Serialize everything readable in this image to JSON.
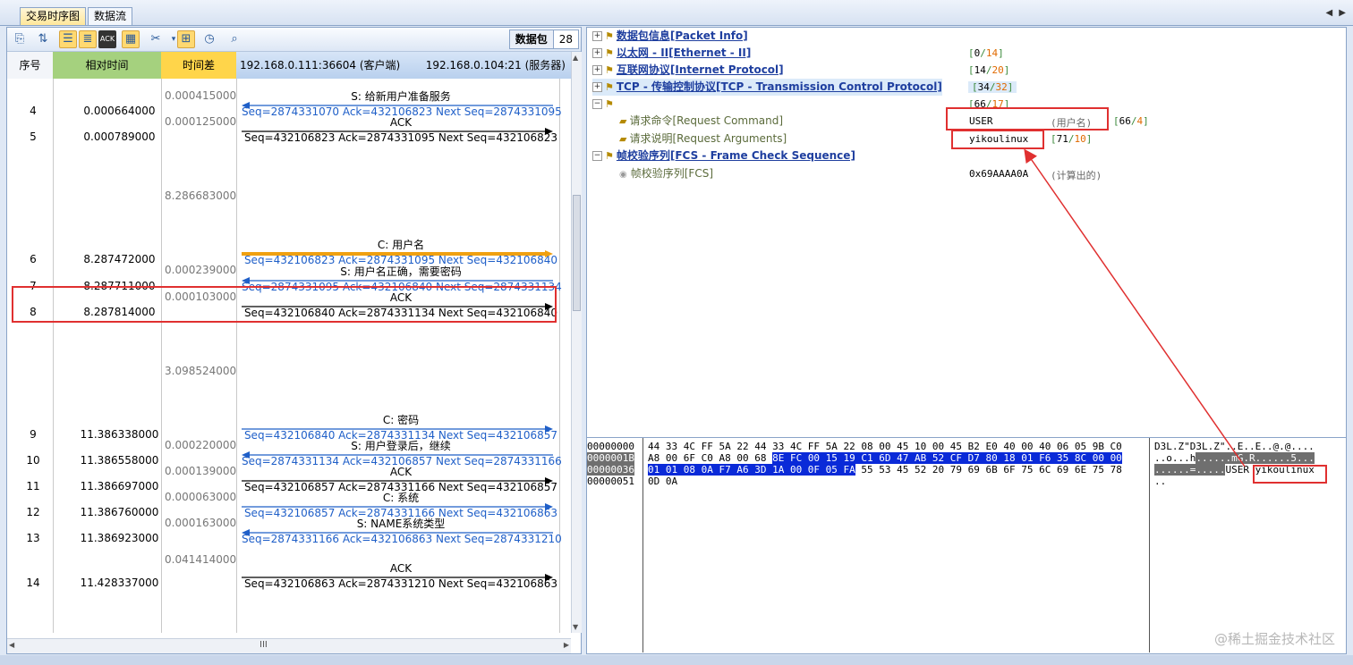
{
  "tabs": [
    "交易时序图",
    "数据流"
  ],
  "tab_nav": "◀ ▶",
  "packet_count": {
    "label": "数据包",
    "value": "28"
  },
  "columns": {
    "num": "序号",
    "rel": "相对时间",
    "delta": "时间差",
    "client": "192.168.0.111:36604 (客户端)",
    "server": "192.168.0.104:21 (服务器)"
  },
  "deltas": [
    "0.000415000",
    "0.000125000",
    "8.286683000",
    "0.000239000",
    "0.000103000",
    "3.098524000",
    "0.000220000",
    "0.000139000",
    "0.000063000",
    "0.000163000",
    "0.041414000"
  ],
  "rows": [
    {
      "num": "4",
      "rel": "0.000664000",
      "label": "S: 给新用户准备服务",
      "seq": "Seq=2874331070  Ack=432106823  Next Seq=2874331095",
      "dir": "left",
      "color": "#1f5fc8"
    },
    {
      "num": "5",
      "rel": "0.000789000",
      "label": "ACK",
      "seq": "Seq=432106823  Ack=2874331095  Next Seq=432106823",
      "dir": "right",
      "color": "#000000"
    },
    {
      "num": "6",
      "rel": "8.287472000",
      "label": "C: 用户名",
      "seq": "Seq=432106823  Ack=2874331095  Next Seq=432106840",
      "dir": "right",
      "color": "#f0a010"
    },
    {
      "num": "7",
      "rel": "8.287711000",
      "label": "S: 用户名正确，需要密码",
      "seq": "Seq=2874331095  Ack=432106840  Next Seq=2874331134",
      "dir": "left",
      "color": "#1f5fc8"
    },
    {
      "num": "8",
      "rel": "8.287814000",
      "label": "ACK",
      "seq": "Seq=432106840  Ack=2874331134  Next Seq=432106840",
      "dir": "right",
      "color": "#000000"
    },
    {
      "num": "9",
      "rel": "11.386338000",
      "label": "C: 密码",
      "seq": "Seq=432106840  Ack=2874331134  Next Seq=432106857",
      "dir": "right",
      "color": "#1f5fc8"
    },
    {
      "num": "10",
      "rel": "11.386558000",
      "label": "S: 用户登录后，继续",
      "seq": "Seq=2874331134  Ack=432106857  Next Seq=2874331166",
      "dir": "left",
      "color": "#1f5fc8"
    },
    {
      "num": "11",
      "rel": "11.386697000",
      "label": "ACK",
      "seq": "Seq=432106857  Ack=2874331166  Next Seq=432106857",
      "dir": "right",
      "color": "#000000"
    },
    {
      "num": "12",
      "rel": "11.386760000",
      "label": "C: 系统",
      "seq": "Seq=432106857  Ack=2874331166  Next Seq=432106863",
      "dir": "right",
      "color": "#1f5fc8"
    },
    {
      "num": "13",
      "rel": "11.386923000",
      "label": "S: NAME系统类型",
      "seq": "Seq=2874331166  Ack=432106863  Next Seq=2874331210",
      "dir": "left",
      "color": "#1f5fc8"
    },
    {
      "num": "14",
      "rel": "11.428337000",
      "label": "ACK",
      "seq": "Seq=432106863  Ack=2874331210  Next Seq=432106863",
      "dir": "right",
      "color": "#000000"
    }
  ],
  "hscroll_grip": "III",
  "tree": [
    {
      "label": "数据包信息[Packet Info]",
      "range": ""
    },
    {
      "label": "以太网 - II[Ethernet - II]",
      "range_a": "0",
      "range_b": "14"
    },
    {
      "label": "互联网协议[Internet Protocol]",
      "range_a": "14",
      "range_b": "20"
    },
    {
      "label": "TCP - 传输控制协议[TCP - Transmission Control Protocol]",
      "range_a": "34",
      "range_b": "32"
    }
  ],
  "ftp_node": {
    "range_a": "66",
    "range_b": "17"
  },
  "ftp_fields": [
    {
      "label": "请求命令[Request Command]",
      "value": "USER",
      "note": "(用户名)",
      "range_a": "66",
      "range_b": "4"
    },
    {
      "label": "请求说明[Request Arguments]",
      "value": "yikoulinux",
      "note": "",
      "range_a": "71",
      "range_b": "10"
    }
  ],
  "fcs": {
    "label": "帧校验序列[FCS - Frame Check Sequence]",
    "sub_label": "帧校验序列[FCS]",
    "value": "0x69AAAA0A",
    "note": "(计算出的)"
  },
  "hex": {
    "offsets": [
      "00000000",
      "0000001B",
      "00000036",
      "00000051"
    ],
    "line0": "44 33 4C FF 5A 22 44 33 4C FF 5A 22 08 00 45 10 00 45 B2 E0 40 00 40 06 05 9B C0",
    "line1_plain": "A8 00 6F C0 A8 00 68 ",
    "line1_sel": "8E FC 00 15 19 C1 6D 47 AB 52 CF D7 80 18 01 F6 35 8C 00 00",
    "line2_sel": "01 01 08 0A F7 A6 3D 1A 00 0F 05 FA",
    "line2_plain": " 55 53 45 52 20 79 69 6B 6F 75 6C 69 6E 75 78",
    "line3": "0D 0A",
    "ascii0": "D3L.Z\"D3L.Z\"..E..E..@.@....",
    "ascii1_plain": "..o...h",
    "ascii1_sel": "......mG.R......5...",
    "ascii2_sel": "......=.....",
    "ascii2_user": "USER ",
    "ascii2_name": "yikoulinux",
    "ascii3": ".."
  },
  "watermark": "@稀土掘金技术社区",
  "colors": {
    "accent": "#e03030",
    "link": "#1f3f9f",
    "selection": "#0a2ad8",
    "delta_header": "#ffd54a",
    "rel_header": "#a5d17e"
  }
}
